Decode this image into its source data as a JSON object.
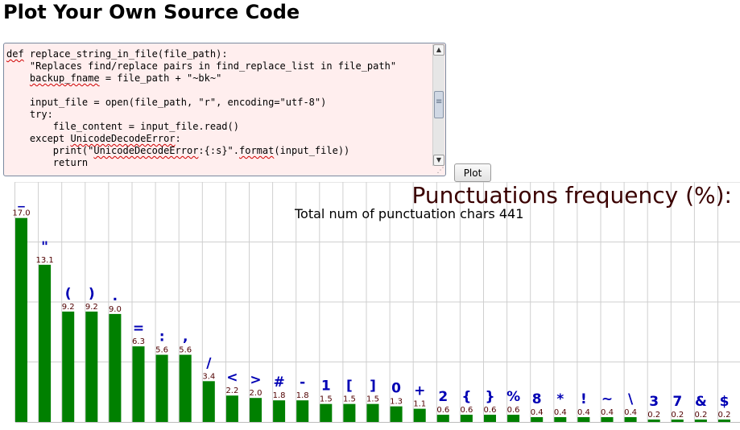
{
  "page": {
    "title": "Plot Your Own Source Code"
  },
  "editor": {
    "lines": [
      [
        {
          "t": "def",
          "s": true
        },
        {
          "t": " replace_string_in_file(file_path):"
        }
      ],
      [
        {
          "t": "    \"Replaces find/replace pairs in find_replace_list in file_path\""
        }
      ],
      [
        {
          "t": "    "
        },
        {
          "t": "backup_fname",
          "s": true
        },
        {
          "t": " = file_path + \"~bk~\""
        }
      ],
      [
        {
          "t": ""
        }
      ],
      [
        {
          "t": "    input_file = open(file_path, \"r\", encoding=\"utf-8\")"
        }
      ],
      [
        {
          "t": "    try:"
        }
      ],
      [
        {
          "t": "        file_content = input_file.read()"
        }
      ],
      [
        {
          "t": "    except "
        },
        {
          "t": "UnicodeDecodeError",
          "s": true
        },
        {
          "t": ":"
        }
      ],
      [
        {
          "t": "        print(\""
        },
        {
          "t": "UnicodeDecodeError",
          "s": true
        },
        {
          "t": ":{:s}\"."
        },
        {
          "t": "format",
          "s": true
        },
        {
          "t": "(input_file))"
        }
      ],
      [
        {
          "t": "        return"
        }
      ]
    ]
  },
  "plot_button": {
    "label": "Plot"
  },
  "colors": {
    "bar": "#008000",
    "symbol": "#0000b4",
    "value_label": "#500000",
    "title": "#3a0000"
  },
  "icons": {
    "scroll_up": "chevron-up-icon",
    "scroll_down": "chevron-down-icon",
    "resize": "resize-grip-icon"
  },
  "chart_data": {
    "type": "bar",
    "title": "Punctuations frequency (%):",
    "subtitle": "Total num of punctuation chars 441",
    "categories": [
      "_",
      "\"",
      "(",
      ")",
      ".",
      "=",
      ":",
      ",",
      "/",
      "<",
      ">",
      "#",
      "-",
      "1",
      "[",
      "]",
      "0",
      "+",
      "2",
      "{",
      "}",
      "%",
      "8",
      "*",
      "!",
      "~",
      "\\",
      "3",
      "7",
      "&",
      "$"
    ],
    "values": [
      17.0,
      13.1,
      9.2,
      9.2,
      9.0,
      6.3,
      5.6,
      5.6,
      3.4,
      2.2,
      2.0,
      1.8,
      1.8,
      1.5,
      1.5,
      1.5,
      1.3,
      1.1,
      0.6,
      0.6,
      0.6,
      0.6,
      0.4,
      0.4,
      0.4,
      0.4,
      0.4,
      0.2,
      0.2,
      0.2,
      0.2
    ],
    "value_labels": [
      "17.0",
      "13.1",
      "9.2",
      "9.2",
      "9.0",
      "6.3",
      "5.6",
      "5.6",
      "3.4",
      "2.2",
      "2.0",
      "1.8",
      "1.8",
      "1.5",
      "1.5",
      "1.5",
      "1.3",
      "1.1",
      "0.6",
      "0.6",
      "0.6",
      "0.6",
      "0.4",
      "0.4",
      "0.4",
      "0.4",
      "0.4",
      "0.2",
      "0.2",
      "0.2",
      "0.2"
    ],
    "ylim": [
      0,
      20
    ],
    "grid": true
  }
}
